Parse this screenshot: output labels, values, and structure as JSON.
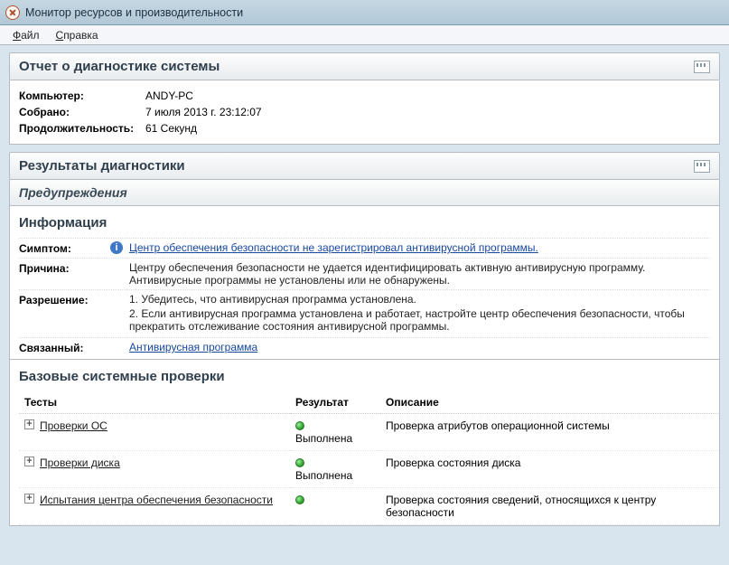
{
  "window": {
    "title": "Монитор ресурсов и производительности"
  },
  "menu": {
    "file": "Файл",
    "help": "Справка"
  },
  "report": {
    "header": "Отчет о диагностике системы",
    "meta": {
      "computer_label": "Компьютер:",
      "computer": "ANDY-PC",
      "collected_label": "Собрано:",
      "collected": "7 июля 2013 г. 23:12:07",
      "duration_label": "Продолжительность:",
      "duration": "61 Секунд"
    }
  },
  "diag": {
    "header": "Результаты диагностики",
    "warnings_header": "Предупреждения"
  },
  "info": {
    "title": "Информация",
    "labels": {
      "symptom": "Симптом:",
      "cause": "Причина:",
      "resolution": "Разрешение:",
      "related": "Связанный:"
    },
    "symptom_link": "Центр обеспечения безопасности не зарегистрировал антивирусной программы.",
    "cause": "Центру обеспечения безопасности не удается идентифицировать активную антивирусную программу. Антивирусные программы не установлены или не обнаружены.",
    "resolution1": "1. Убедитесь, что антивирусная программа установлена.",
    "resolution2": "2. Если антивирусная программа установлена и работает, настройте центр обеспечения безопасности, чтобы прекратить отслеживание состояния антивирусной программы.",
    "related_link": "Антивирусная программа"
  },
  "checks": {
    "title": "Базовые системные проверки",
    "cols": {
      "tests": "Тесты",
      "result": "Результат",
      "desc": "Описание"
    },
    "rows": [
      {
        "test": "Проверки ОС",
        "result": "Выполнена",
        "desc": "Проверка атрибутов операционной системы"
      },
      {
        "test": "Проверки диска",
        "result": "Выполнена",
        "desc": "Проверка состояния диска"
      },
      {
        "test": "Испытания центра обеспечения безопасности",
        "result": "",
        "desc": "Проверка состояния сведений, относящихся к центру безопасности"
      }
    ]
  }
}
